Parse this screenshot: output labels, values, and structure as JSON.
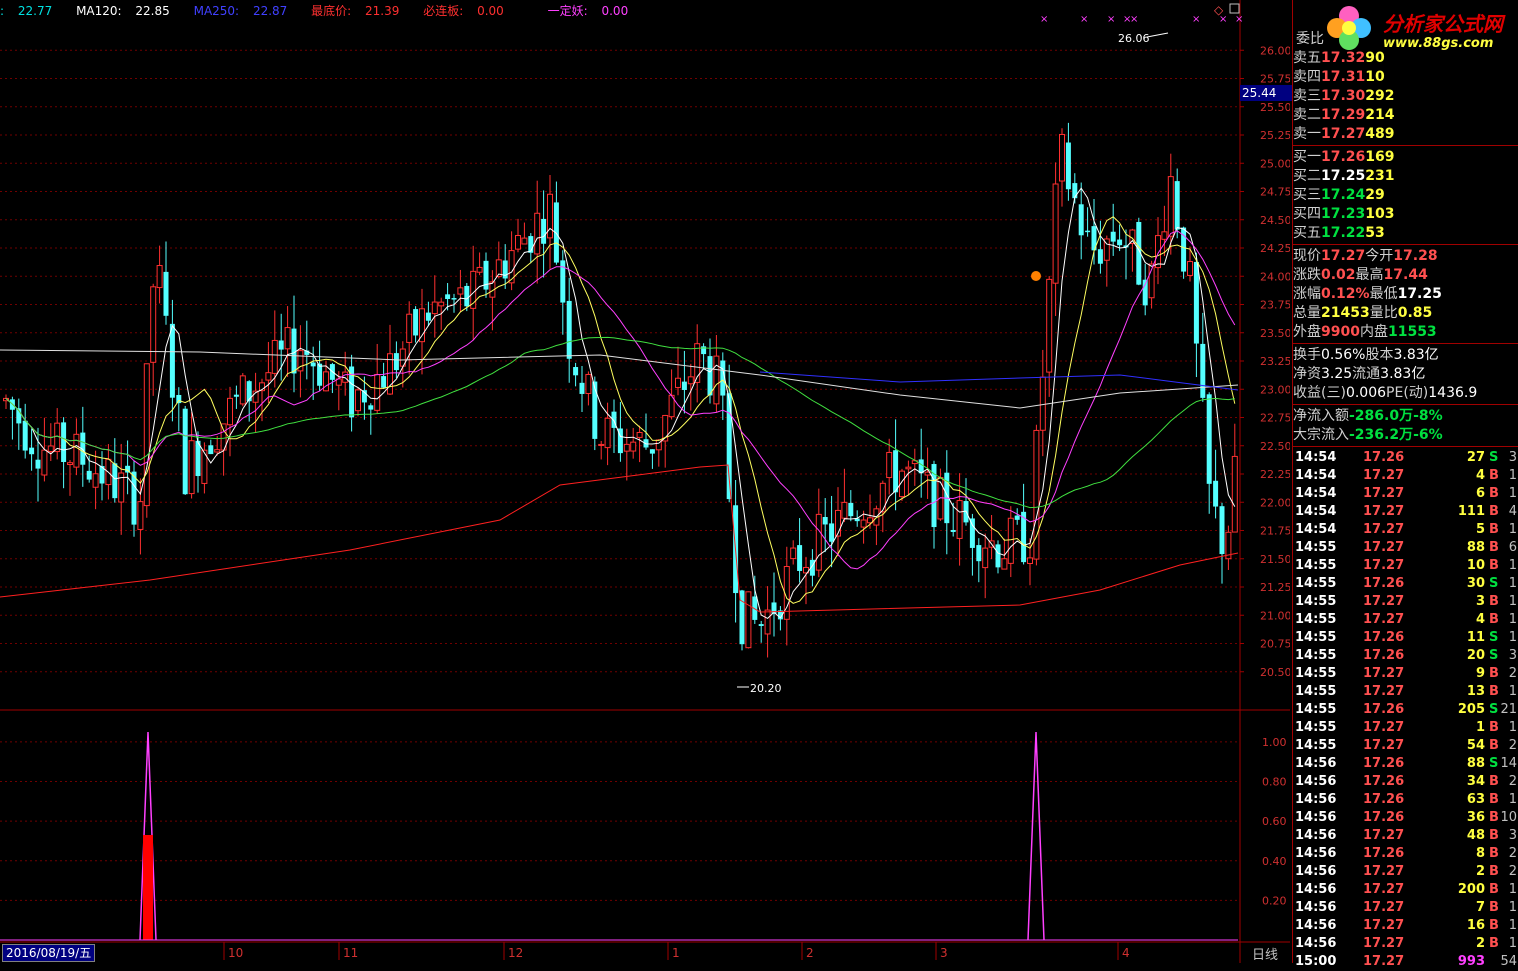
{
  "header": {
    "ma_a": {
      "label": ":",
      "value": "22.77",
      "color": "#00e0e0"
    },
    "ma120": {
      "label": "MA120:",
      "value": "22.85",
      "color": "#ffffff"
    },
    "ma250": {
      "label": "MA250:",
      "value": "22.87",
      "color": "#4040ff"
    },
    "lowest": {
      "label": "最底价:",
      "value": "21.39",
      "color": "#ff3030"
    },
    "limit_up": {
      "label": "必连板:",
      "value": "0.00",
      "color": "#ff3030"
    },
    "yiding": {
      "label": "一定妖:",
      "value": "0.00",
      "color": "#ff40ff"
    }
  },
  "price_axis": [
    "26.00",
    "25.75",
    "25.50",
    "25.25",
    "25.00",
    "24.75",
    "24.50",
    "24.25",
    "24.00",
    "23.75",
    "23.50",
    "23.25",
    "23.00",
    "22.75",
    "22.50",
    "22.25",
    "22.00",
    "21.75",
    "21.50",
    "21.25",
    "21.00",
    "20.75",
    "20.50"
  ],
  "indicator_axis": [
    "1.00",
    "0.80",
    "0.60",
    "0.40",
    "0.20"
  ],
  "time_axis": [
    "10",
    "11",
    "12",
    "1",
    "2",
    "3",
    "4"
  ],
  "annotations": {
    "high": "26.06",
    "low": "20.20",
    "last_price": "25.44"
  },
  "footer": {
    "date": "2016/08/19/五",
    "period": "日线"
  },
  "logo": {
    "title": "分析家公式网",
    "url": "www.88gs.com"
  },
  "order_book": {
    "header_label": "委比",
    "sells": [
      {
        "label": "卖五",
        "price": "17.32",
        "vol": "90"
      },
      {
        "label": "卖四",
        "price": "17.31",
        "vol": "10"
      },
      {
        "label": "卖三",
        "price": "17.30",
        "vol": "292"
      },
      {
        "label": "卖二",
        "price": "17.29",
        "vol": "214"
      },
      {
        "label": "卖一",
        "price": "17.27",
        "vol": "489"
      }
    ],
    "buys": [
      {
        "label": "买一",
        "price": "17.26",
        "vol": "169"
      },
      {
        "label": "买二",
        "price": "17.25",
        "vol": "231"
      },
      {
        "label": "买三",
        "price": "17.24",
        "vol": "29"
      },
      {
        "label": "买四",
        "price": "17.23",
        "vol": "103"
      },
      {
        "label": "买五",
        "price": "17.22",
        "vol": "53"
      }
    ]
  },
  "quote": [
    {
      "l1": "现价",
      "v1": "17.27",
      "l2": "今开",
      "v2": "17.28"
    },
    {
      "l1": "涨跌",
      "v1": "0.02",
      "l2": "最高",
      "v2": "17.44"
    },
    {
      "l1": "涨幅",
      "v1": "0.12%",
      "l2": "最低",
      "v2": "17.25"
    },
    {
      "l1": "总量",
      "v1": "21453",
      "l2": "量比",
      "v2": "0.85"
    },
    {
      "l1": "外盘",
      "v1": "9900",
      "l2": "内盘",
      "v2": "11553"
    }
  ],
  "stats": [
    {
      "l1": "换手",
      "v1": "0.56%",
      "l2": "股本",
      "v2": "3.83亿"
    },
    {
      "l1": "净资",
      "v1": "3.25",
      "l2": "流通",
      "v2": "3.83亿"
    },
    {
      "l1": "收益(三)",
      "v1": "0.006",
      "l2": "PE(动)",
      "v2": "1436.9"
    }
  ],
  "flows": [
    {
      "label": "净流入额",
      "value": "-286.0万",
      "pct": "-8%"
    },
    {
      "label": "大宗流入",
      "value": "-236.2万",
      "pct": "-6%"
    }
  ],
  "ticks": [
    {
      "t": "14:54",
      "p": "17.26",
      "v": "27",
      "s": "S",
      "n": "3"
    },
    {
      "t": "14:54",
      "p": "17.27",
      "v": "4",
      "s": "B",
      "n": "1"
    },
    {
      "t": "14:54",
      "p": "17.27",
      "v": "6",
      "s": "B",
      "n": "1"
    },
    {
      "t": "14:54",
      "p": "17.27",
      "v": "111",
      "s": "B",
      "n": "4"
    },
    {
      "t": "14:54",
      "p": "17.27",
      "v": "5",
      "s": "B",
      "n": "1"
    },
    {
      "t": "14:55",
      "p": "17.27",
      "v": "88",
      "s": "B",
      "n": "6"
    },
    {
      "t": "14:55",
      "p": "17.27",
      "v": "10",
      "s": "B",
      "n": "1"
    },
    {
      "t": "14:55",
      "p": "17.26",
      "v": "30",
      "s": "S",
      "n": "1"
    },
    {
      "t": "14:55",
      "p": "17.27",
      "v": "3",
      "s": "B",
      "n": "1"
    },
    {
      "t": "14:55",
      "p": "17.27",
      "v": "4",
      "s": "B",
      "n": "1"
    },
    {
      "t": "14:55",
      "p": "17.26",
      "v": "11",
      "s": "S",
      "n": "1"
    },
    {
      "t": "14:55",
      "p": "17.26",
      "v": "20",
      "s": "S",
      "n": "3"
    },
    {
      "t": "14:55",
      "p": "17.27",
      "v": "9",
      "s": "B",
      "n": "2"
    },
    {
      "t": "14:55",
      "p": "17.27",
      "v": "13",
      "s": "B",
      "n": "1"
    },
    {
      "t": "14:55",
      "p": "17.26",
      "v": "205",
      "s": "S",
      "n": "21"
    },
    {
      "t": "14:55",
      "p": "17.27",
      "v": "1",
      "s": "B",
      "n": "1"
    },
    {
      "t": "14:55",
      "p": "17.27",
      "v": "54",
      "s": "B",
      "n": "2"
    },
    {
      "t": "14:56",
      "p": "17.26",
      "v": "88",
      "s": "S",
      "n": "14"
    },
    {
      "t": "14:56",
      "p": "17.26",
      "v": "34",
      "s": "B",
      "n": "2"
    },
    {
      "t": "14:56",
      "p": "17.26",
      "v": "63",
      "s": "B",
      "n": "1"
    },
    {
      "t": "14:56",
      "p": "17.26",
      "v": "36",
      "s": "B",
      "n": "10"
    },
    {
      "t": "14:56",
      "p": "17.27",
      "v": "48",
      "s": "B",
      "n": "3"
    },
    {
      "t": "14:56",
      "p": "17.26",
      "v": "8",
      "s": "B",
      "n": "2"
    },
    {
      "t": "14:56",
      "p": "17.27",
      "v": "2",
      "s": "B",
      "n": "2"
    },
    {
      "t": "14:56",
      "p": "17.27",
      "v": "200",
      "s": "B",
      "n": "1"
    },
    {
      "t": "14:56",
      "p": "17.27",
      "v": "7",
      "s": "B",
      "n": "1"
    },
    {
      "t": "14:56",
      "p": "17.27",
      "v": "16",
      "s": "B",
      "n": "1"
    },
    {
      "t": "14:56",
      "p": "17.27",
      "v": "2",
      "s": "B",
      "n": "1"
    },
    {
      "t": "15:00",
      "p": "17.27",
      "v": "993",
      "s": "",
      "n": "54"
    }
  ],
  "colors": {
    "up": "#ff3030",
    "down": "#54ffff",
    "grid": "#a00000"
  }
}
